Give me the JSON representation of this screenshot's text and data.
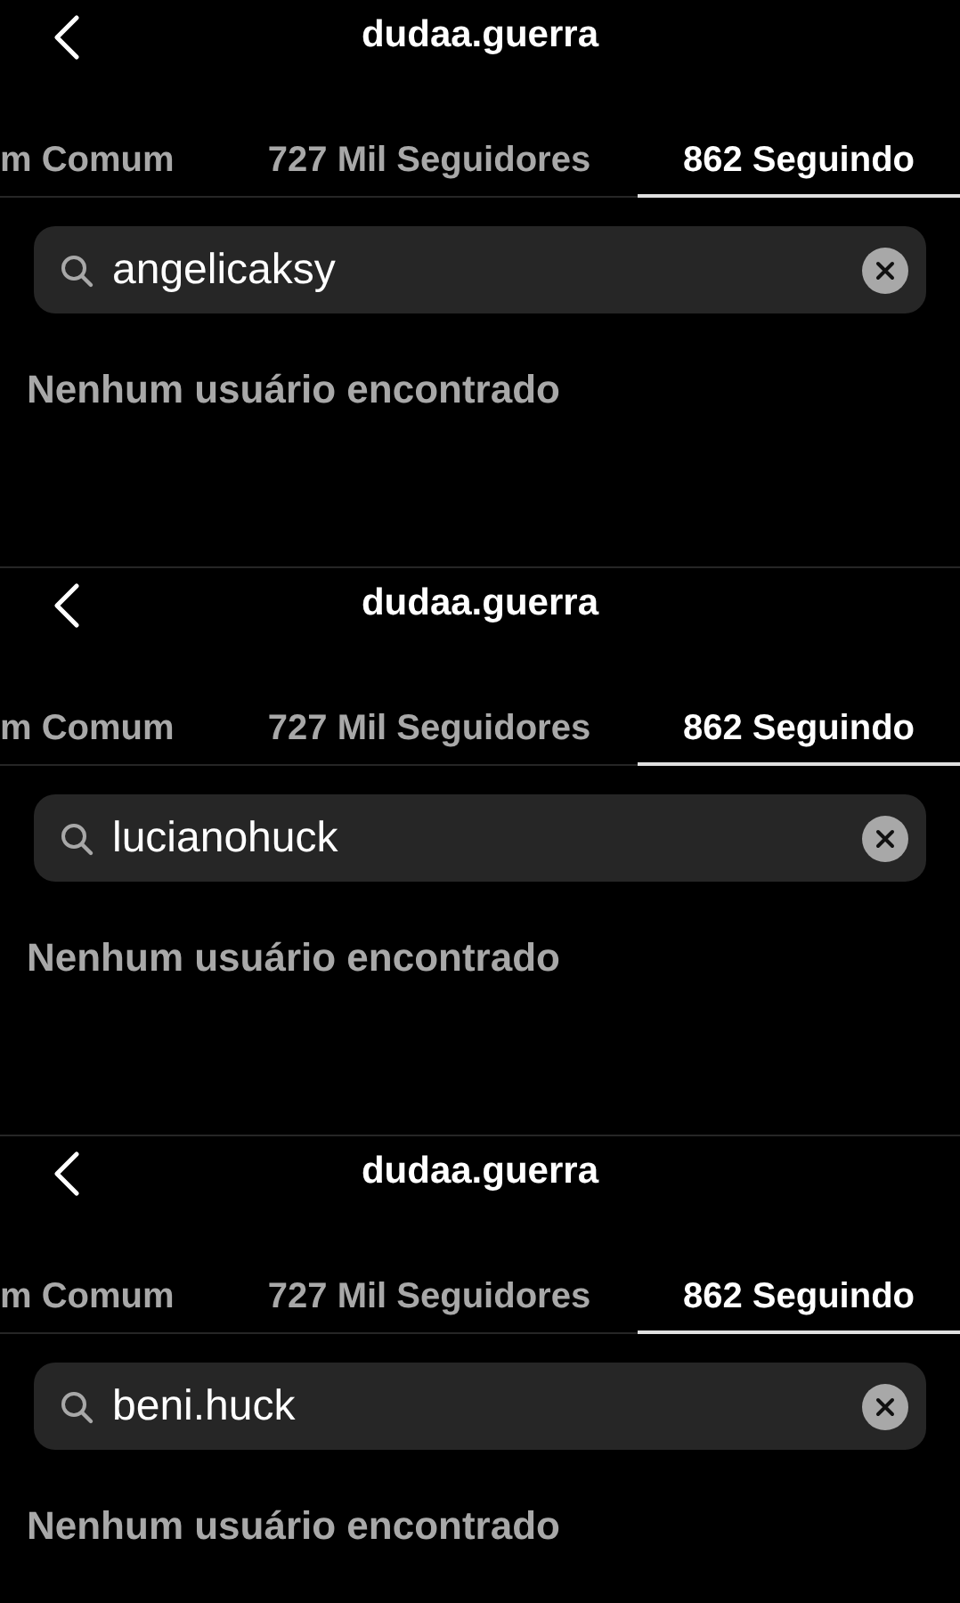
{
  "panels": [
    {
      "title": "dudaa.guerra",
      "tabs": [
        {
          "label": "m Comum",
          "selected": false
        },
        {
          "label": "727 Mil Seguidores",
          "selected": false
        },
        {
          "label": "862 Seguindo",
          "selected": true
        }
      ],
      "search": {
        "value": "angelicaksy"
      },
      "message": "Nenhum usuário encontrado"
    },
    {
      "title": "dudaa.guerra",
      "tabs": [
        {
          "label": "m Comum",
          "selected": false
        },
        {
          "label": "727 Mil Seguidores",
          "selected": false
        },
        {
          "label": "862 Seguindo",
          "selected": true
        }
      ],
      "search": {
        "value": "lucianohuck"
      },
      "message": "Nenhum usuário encontrado"
    },
    {
      "title": "dudaa.guerra",
      "tabs": [
        {
          "label": "m Comum",
          "selected": false
        },
        {
          "label": "727 Mil Seguidores",
          "selected": false
        },
        {
          "label": "862 Seguindo",
          "selected": true
        }
      ],
      "search": {
        "value": "beni.huck"
      },
      "message": "Nenhum usuário encontrado"
    }
  ]
}
